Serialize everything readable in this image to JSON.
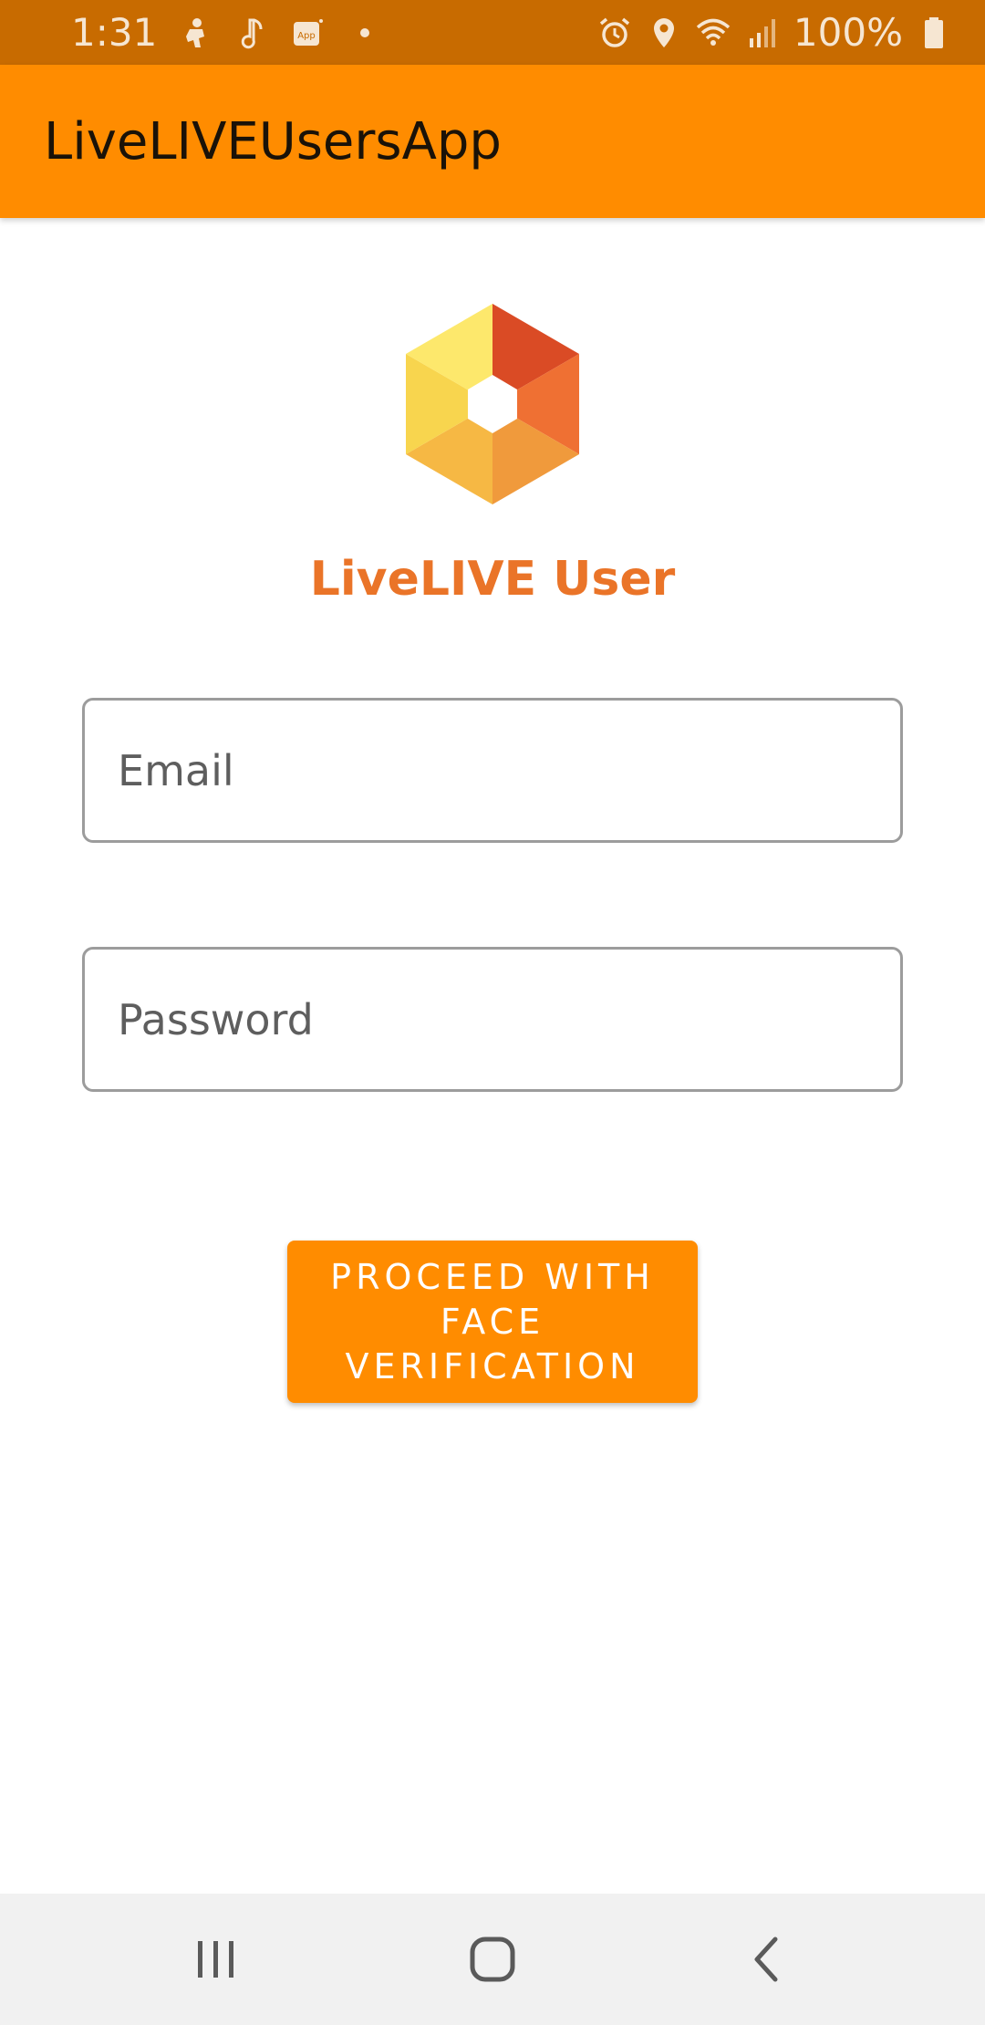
{
  "status_bar": {
    "time": "1:31",
    "battery": "100%",
    "left_icons": [
      "person-icon",
      "music-note-icon",
      "app-icon",
      "dot-icon"
    ],
    "right_icons": [
      "alarm-icon",
      "location-icon",
      "wifi-icon",
      "signal-icon",
      "battery-icon"
    ]
  },
  "app_bar": {
    "title": "LiveLIVEUsersApp"
  },
  "login": {
    "brand_title": "LiveLIVE User",
    "email_placeholder": "Email",
    "password_placeholder": "Password",
    "proceed_label": "PROCEED WITH FACE VERIFICATION"
  },
  "nav_bar": {
    "icons": [
      "recents-icon",
      "home-icon",
      "back-icon"
    ]
  },
  "colors": {
    "status_bar": "#c86b00",
    "app_bar": "#ff8c00",
    "accent": "#ea7428",
    "nav_bar": "#f1f1f1"
  }
}
